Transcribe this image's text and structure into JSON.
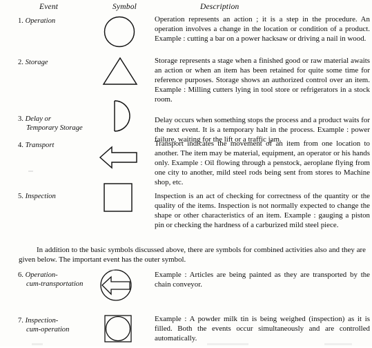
{
  "document": {
    "type": "textbook-page",
    "topic": "Process chart symbols"
  },
  "table": {
    "headers": {
      "event": "Event",
      "symbol": "Symbol",
      "description": "Description"
    },
    "rows": [
      {
        "number": "1.",
        "event": "Operation",
        "event_line2": "",
        "symbol_name": "circle-symbol",
        "description": "Operation represents an action ; it is a step in the procedure. An operation involves a change in the location or condition of a product. Example : cutting a bar on a power hacksaw or driving a nail in wood."
      },
      {
        "number": "2.",
        "event": "Storage",
        "event_line2": "",
        "symbol_name": "triangle-symbol",
        "description": "Storage represents a stage when a finished good or raw material awaits an action or when an item has been retained for quite some time for reference purposes. Storage shows an authorized control over an item. Example : Milling cutters lying in tool store or refrigerators in a stock room."
      },
      {
        "number": "3.",
        "event": "Delay or",
        "event_line2": "Temporary Storage",
        "symbol_name": "d-shape-symbol",
        "description": "Delay occurs when something stops the  process  and a product waits for the next event. It is a temporary halt in the process. Example : power failure, waiting for the lift or a traffic jam."
      },
      {
        "number": "4.",
        "event": "Transport",
        "event_line2": "",
        "symbol_name": "left-arrow-symbol",
        "description": "Transport indicates the movement of an item from one location to another. The item may be material, equipment, an operator or his hands only. Example : Oil flowing through a penstock, aeroplane flying from one city to another, mild steel rods being sent from stores to Machine shop, etc."
      },
      {
        "number": "5.",
        "event": "Inspection",
        "event_line2": "",
        "symbol_name": "square-symbol",
        "description": "Inspection is an act of checking for correctness of the quantity or the quality of the items. Inspection is not normally expected to change the shape or other characteristics of an item. Example : gauging a piston pin or checking the hardness of a carburized mild steel piece."
      }
    ],
    "combined_rows": [
      {
        "number": "6.",
        "event": "Operation-",
        "event_line2": "cum-transportation",
        "symbol_name": "circle-with-arrow-symbol",
        "description": "Example : Articles are being painted as they are transported by the chain conveyor."
      },
      {
        "number": "7.",
        "event": "Inspection-",
        "event_line2": "cum-operation",
        "symbol_name": "square-with-circle-symbol",
        "description": "Example : A powder milk tin is being weighed (inspection) as it is filled. Both the events occur simultaneously and are controlled automatically."
      }
    ]
  },
  "note": "In addition to the basic symbols discussed above, there are symbols for combined activities also and they are given below. The important event has the outer symbol.",
  "colors": {
    "ink": "#111111",
    "paper": "#fdfdfb"
  }
}
